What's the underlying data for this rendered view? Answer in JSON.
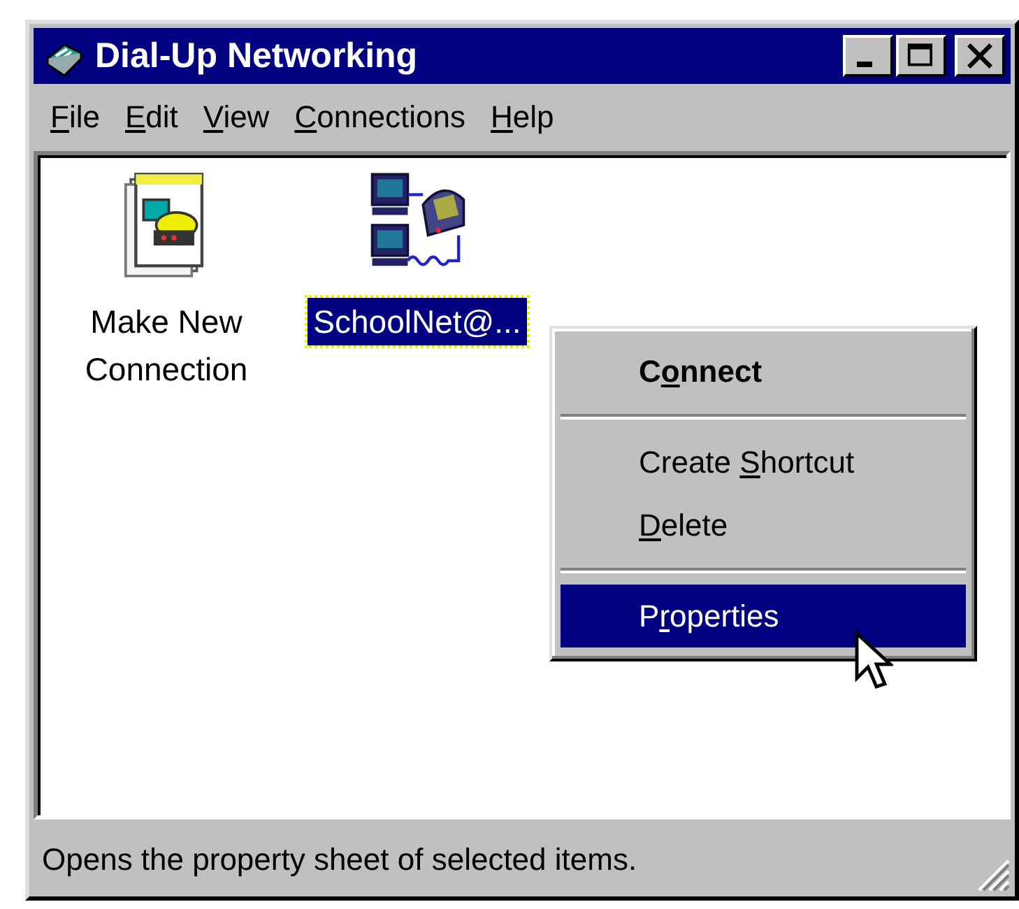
{
  "window": {
    "title": "Dial-Up Networking"
  },
  "menu_bar": [
    {
      "key": "F",
      "post": "ile"
    },
    {
      "key": "E",
      "post": "dit"
    },
    {
      "key": "V",
      "post": "iew"
    },
    {
      "key": "C",
      "post": "onnections"
    },
    {
      "key": "H",
      "post": "elp"
    }
  ],
  "icons": [
    {
      "kind": "new",
      "lines": [
        "Make New",
        "Connection"
      ],
      "selected": false
    },
    {
      "kind": "connection",
      "lines": [
        "SchoolNet@..."
      ],
      "selected": true
    }
  ],
  "context_menu": [
    {
      "kind": "item",
      "pre": "C",
      "key": "o",
      "post": "nnect",
      "default": true,
      "selected": false
    },
    {
      "kind": "separator"
    },
    {
      "kind": "item",
      "pre": "Create ",
      "key": "S",
      "post": "hortcut",
      "default": false,
      "selected": false
    },
    {
      "kind": "item",
      "key": "D",
      "post": "elete",
      "default": false,
      "selected": false
    },
    {
      "kind": "separator"
    },
    {
      "kind": "item",
      "pre": "P",
      "key": "r",
      "post": "operties",
      "default": false,
      "selected": true
    }
  ],
  "status_bar": {
    "text": "Opens the property sheet of selected items."
  }
}
